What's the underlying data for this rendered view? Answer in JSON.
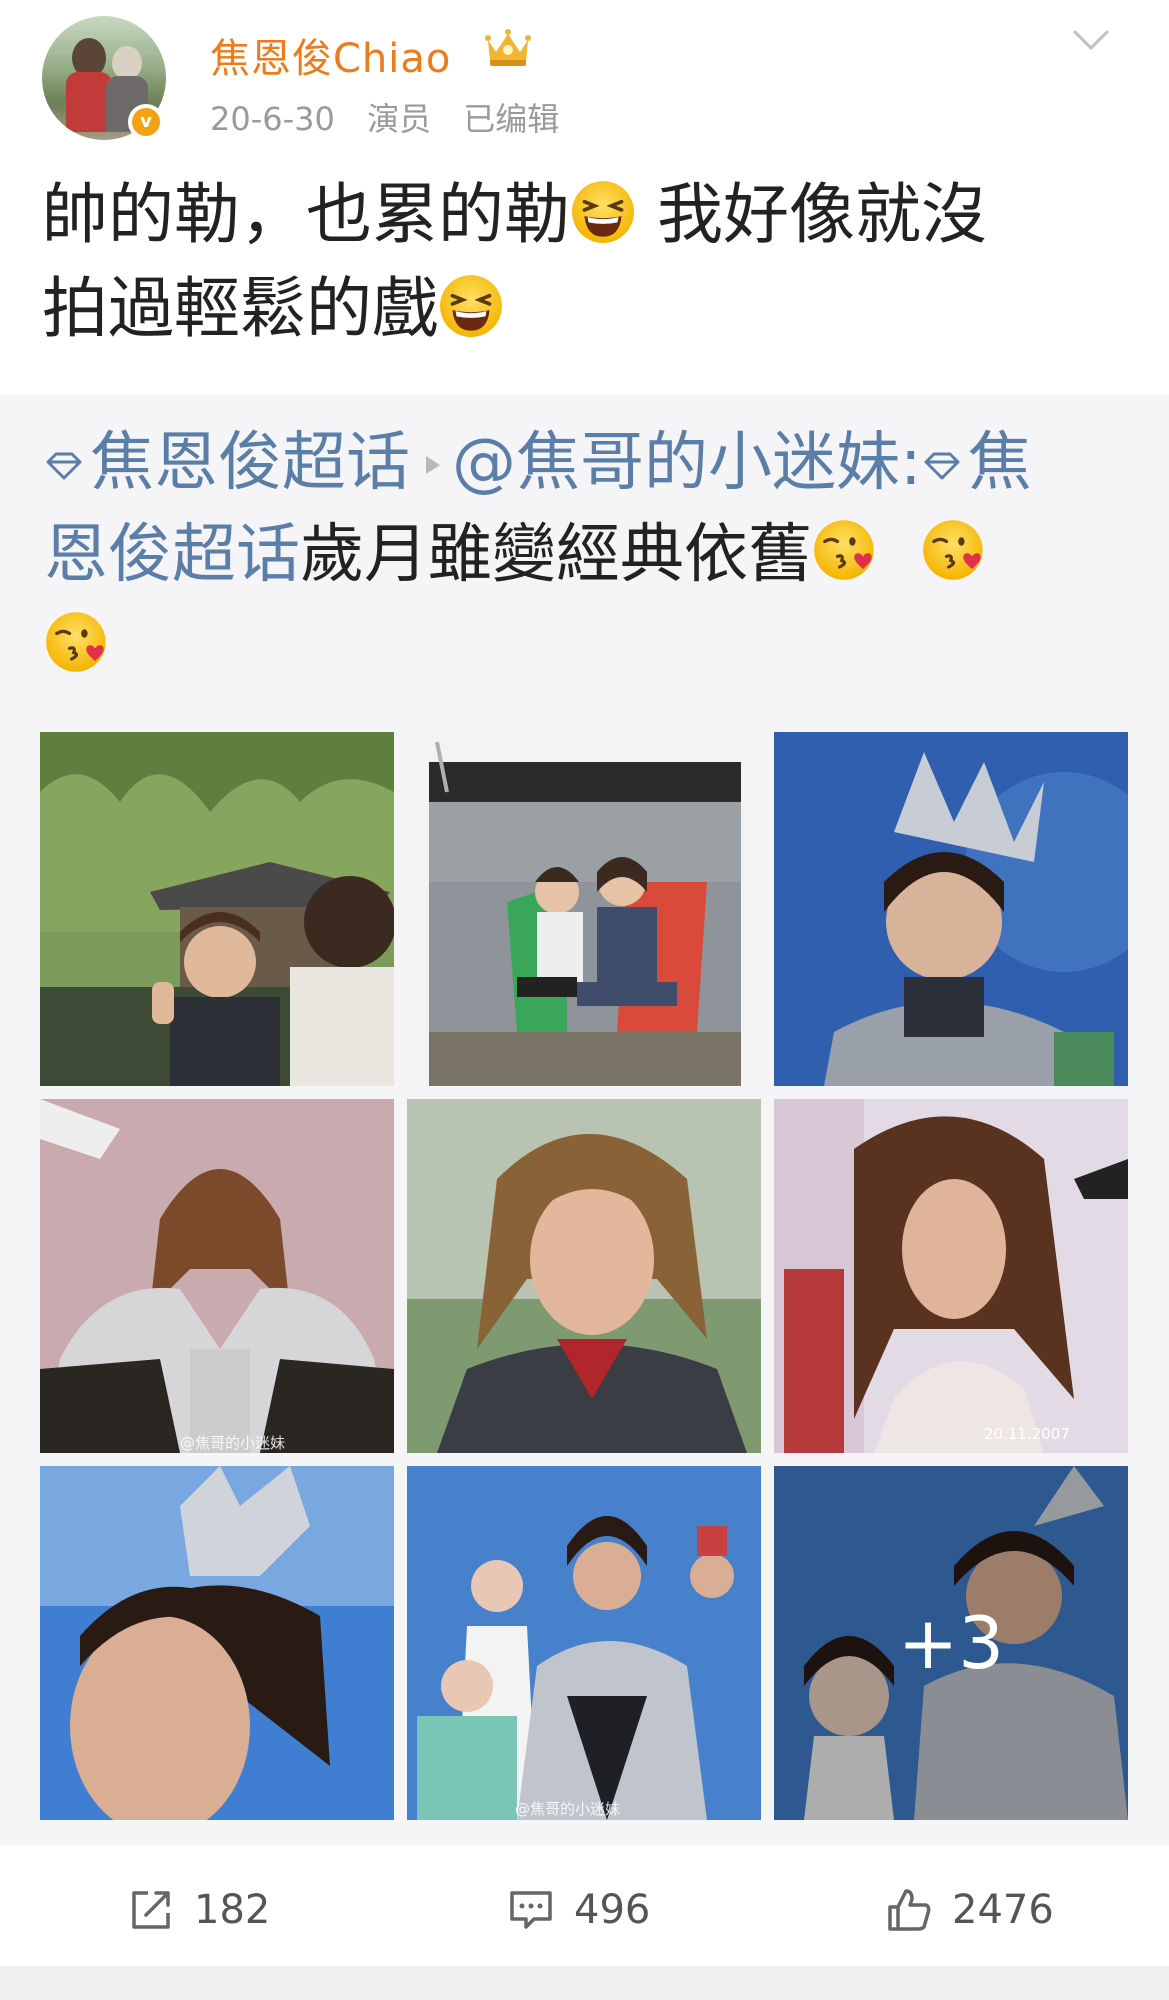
{
  "user": {
    "name": "焦恩俊Chiao",
    "date": "20-6-30",
    "role": "演员",
    "edited": "已编辑",
    "verified_badge": "v",
    "crown_icon": "crown-icon"
  },
  "post": {
    "line1_a": "帥的勒，也累的勒",
    "line1_b": " 我好像就沒",
    "line2_a": "拍過輕鬆的戲",
    "emoji": "laughing-emoji"
  },
  "repost": {
    "topic1": "焦恩俊超话",
    "mention": "@焦哥的小迷妹:",
    "topic2_a": "焦",
    "topic2_b": "恩俊超话",
    "text": "歲月雖變經典依舊",
    "emoji": "kiss-heart-emoji",
    "more_count": "+3",
    "watermark_1": "@焦哥的小迷妹",
    "watermark_2": "20.11.2007",
    "watermark_3": "@焦哥的小迷妹"
  },
  "actions": {
    "repost_count": "182",
    "comment_count": "496",
    "like_count": "2476"
  },
  "colors": {
    "username": "#f07a1a",
    "link": "#5b7ea8",
    "meta": "#9a9a9a",
    "repost_bg": "#f5f5f7"
  }
}
